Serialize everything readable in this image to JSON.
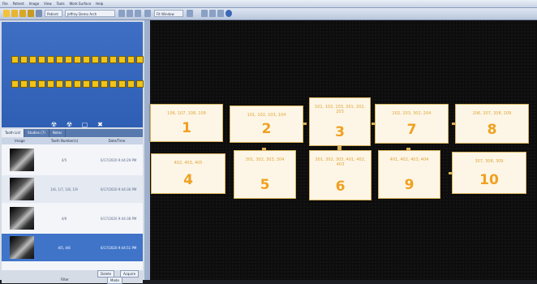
{
  "menubar": {
    "items": [
      "File",
      "Patient",
      "Image",
      "View",
      "Tools",
      "Work Surface",
      "Help"
    ]
  },
  "toolbar": {
    "patient_label": "Patient",
    "image_selector": "Jeffrey Demo Arch",
    "zoom_field": "Fit Window"
  },
  "tooth_chart": {
    "upper_count": 16,
    "lower_count": 16,
    "tool_icons": [
      "radiation-icon",
      "radiation-alt-icon",
      "blank-icon",
      "close-icon"
    ]
  },
  "tabs": [
    "Tooth List",
    "Studies (7)",
    "Notes"
  ],
  "table": {
    "headers": [
      "Image",
      "Tooth Number(s)",
      "Date/Time"
    ],
    "rows": [
      {
        "teeth": "4/5",
        "datetime": "6/17/2020 9:44:29 PM",
        "selected": false
      },
      {
        "teeth": "1/6, 1/7, 1/8, 1/9",
        "datetime": "6/17/2020 9:44:36 PM",
        "selected": false
      },
      {
        "teeth": "4/6",
        "datetime": "6/17/2020 9:44:38 PM",
        "selected": false
      },
      {
        "teeth": "4/5, 4/6",
        "datetime": "6/17/2020 9:44:51 PM",
        "selected": true
      }
    ]
  },
  "bottom_bar": {
    "delete_label": "Delete",
    "acquire_label": "Acquire",
    "filter_label": "Filter",
    "mode_label": "Mode"
  },
  "cards": [
    {
      "number": "1",
      "teeth": "106, 107, 108, 109"
    },
    {
      "number": "2",
      "teeth": "101, 102, 103, 104"
    },
    {
      "number": "3",
      "teeth": "101, 102, 103, 201, 202, 203"
    },
    {
      "number": "7",
      "teeth": "202, 203, 302, 204"
    },
    {
      "number": "8",
      "teeth": "206, 207, 208, 209"
    },
    {
      "number": "4",
      "teeth": "402, 403, 405"
    },
    {
      "number": "5",
      "teeth": "301, 302, 303, 304"
    },
    {
      "number": "6",
      "teeth": "301, 302, 303, 401, 402, 403"
    },
    {
      "number": "9",
      "teeth": "401, 402, 403, 404"
    },
    {
      "number": "10",
      "teeth": "307, 308, 309"
    }
  ],
  "colors": {
    "card_text": "#e0a43a",
    "card_bg": "#fdf6e6",
    "selected_row": "#3f74c9",
    "tooth": "#f0c419"
  }
}
